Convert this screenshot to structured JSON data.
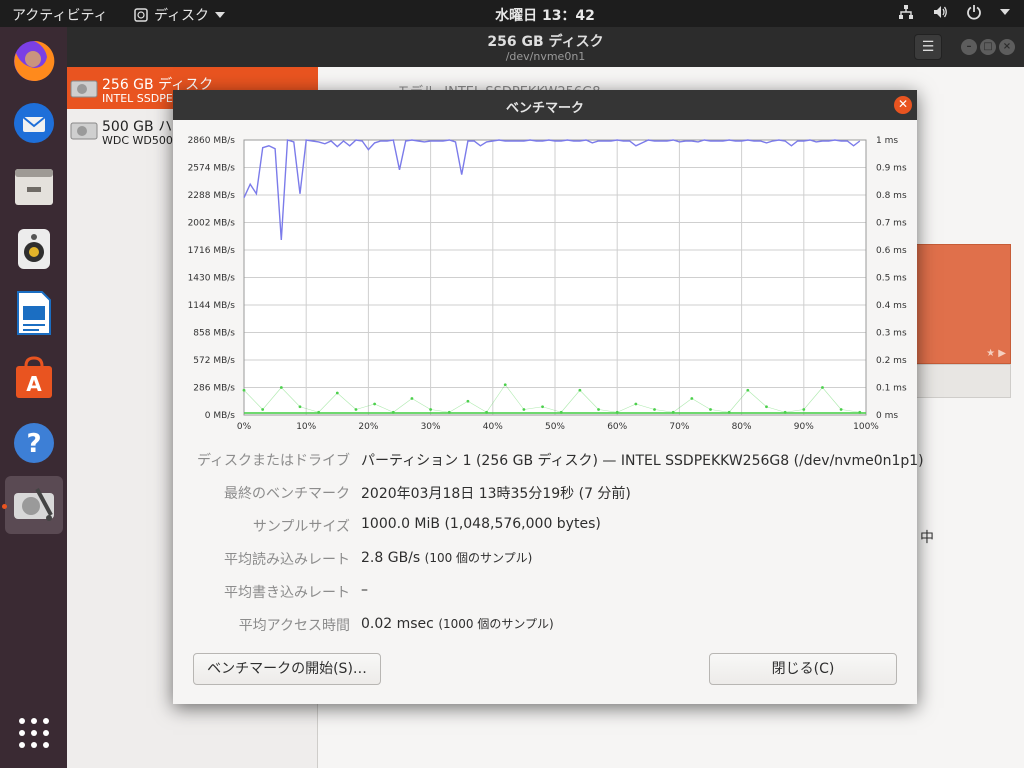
{
  "topbar": {
    "activities": "アクティビティ",
    "app_name": "ディスク",
    "clock": "水曜日 13：42"
  },
  "dock": {
    "items": [
      "firefox-icon",
      "thunderbird-icon",
      "files-icon",
      "rhythmbox-icon",
      "writer-icon",
      "software-icon",
      "help-icon",
      "disks-icon",
      "app-grid-icon"
    ]
  },
  "main_window": {
    "title": "256 GB ディスク",
    "subtitle": "/dev/nvme0n1",
    "drives": [
      {
        "name": "256 GB ディスク",
        "model": "INTEL SSDPE"
      },
      {
        "name": "500 GB ハー",
        "model": "WDC WD500"
      }
    ],
    "model_label": "モデル",
    "model_value": "INTEL SSDPEKKW256G8",
    "partial_text": "中"
  },
  "dialog": {
    "title": "ベンチマーク",
    "rows": [
      {
        "label": "ディスクまたはドライブ",
        "value": "パーティション 1 (256 GB ディスク) — INTEL SSDPEKKW256G8 (/dev/nvme0n1p1)",
        "note": ""
      },
      {
        "label": "最終のベンチマーク",
        "value": "2020年03月18日 13時35分19秒 (7 分前)",
        "note": ""
      },
      {
        "label": "サンプルサイズ",
        "value": "1000.0 MiB (1,048,576,000 bytes)",
        "note": ""
      },
      {
        "label": "平均読み込みレート",
        "value": "2.8 GB/s",
        "note": "(100 個のサンプル)"
      },
      {
        "label": "平均書き込みレート",
        "value": "–",
        "note": ""
      },
      {
        "label": "平均アクセス時間",
        "value": "0.02 msec",
        "note": "(1000 個のサンプル)"
      }
    ],
    "start_button": "ベンチマークの開始(S)…",
    "close_button": "閉じる(C)"
  },
  "chart_data": {
    "type": "line",
    "x_ticks": [
      "0%",
      "10%",
      "20%",
      "30%",
      "40%",
      "50%",
      "60%",
      "70%",
      "80%",
      "90%",
      "100%"
    ],
    "y_left_ticks": [
      "2860 MB/s",
      "2574 MB/s",
      "2288 MB/s",
      "2002 MB/s",
      "1716 MB/s",
      "1430 MB/s",
      "1144 MB/s",
      "858 MB/s",
      "572 MB/s",
      "286 MB/s",
      "0 MB/s"
    ],
    "y_right_ticks": [
      "1 ms",
      "0.9 ms",
      "0.8 ms",
      "0.7 ms",
      "0.6 ms",
      "0.5 ms",
      "0.4 ms",
      "0.3 ms",
      "0.2 ms",
      "0.1 ms",
      "0 ms"
    ],
    "xlim": [
      0,
      100
    ],
    "ylim_left": [
      0,
      2860
    ],
    "ylim_right": [
      0,
      1
    ],
    "grid": true,
    "series": [
      {
        "color": "#7b7bea",
        "x": [
          0,
          1,
          2,
          3,
          4,
          5,
          6,
          7,
          8,
          9,
          10,
          11,
          12,
          13,
          14,
          15,
          16,
          17,
          18,
          19,
          20,
          21,
          22,
          23,
          24,
          25,
          26,
          27,
          28,
          29,
          30,
          31,
          32,
          33,
          34,
          35,
          36,
          37,
          38,
          39,
          40,
          41,
          42,
          43,
          44,
          45,
          46,
          47,
          48,
          49,
          50,
          51,
          52,
          53,
          54,
          55,
          56,
          57,
          58,
          59,
          60,
          61,
          62,
          63,
          64,
          65,
          66,
          67,
          68,
          69,
          70,
          71,
          72,
          73,
          74,
          75,
          76,
          77,
          78,
          79,
          80,
          81,
          82,
          83,
          84,
          85,
          86,
          87,
          88,
          89,
          90,
          91,
          92,
          93,
          94,
          95,
          96,
          97,
          98,
          99
        ],
        "values": [
          2260,
          2400,
          2300,
          2780,
          2800,
          2770,
          1820,
          2860,
          2840,
          2300,
          2860,
          2850,
          2840,
          2820,
          2850,
          2790,
          2850,
          2800,
          2860,
          2850,
          2760,
          2830,
          2850,
          2850,
          2860,
          2550,
          2850,
          2860,
          2850,
          2840,
          2850,
          2850,
          2850,
          2860,
          2840,
          2500,
          2850,
          2850,
          2800,
          2840,
          2850,
          2860,
          2850,
          2850,
          2850,
          2850,
          2860,
          2850,
          2850,
          2860,
          2850,
          2850,
          2860,
          2850,
          2850,
          2860,
          2830,
          2850,
          2850,
          2850,
          2860,
          2850,
          2850,
          2800,
          2830,
          2860,
          2850,
          2850,
          2850,
          2860,
          2840,
          2850,
          2850,
          2840,
          2860,
          2850,
          2850,
          2850,
          2860,
          2850,
          2850,
          2860,
          2850,
          2850,
          2830,
          2850,
          2860,
          2850,
          2800,
          2850,
          2850,
          2860,
          2840,
          2850,
          2850,
          2860,
          2850,
          2850,
          2800,
          2850
        ]
      },
      {
        "color": "#4cd04c",
        "axis": "right",
        "x": [
          0,
          3,
          6,
          9,
          12,
          15,
          18,
          21,
          24,
          27,
          30,
          33,
          36,
          39,
          42,
          45,
          48,
          51,
          54,
          57,
          60,
          63,
          66,
          69,
          72,
          75,
          78,
          81,
          84,
          87,
          90,
          93,
          96,
          99
        ],
        "values": [
          0.09,
          0.02,
          0.1,
          0.03,
          0.01,
          0.08,
          0.02,
          0.04,
          0.01,
          0.06,
          0.02,
          0.01,
          0.05,
          0.01,
          0.11,
          0.02,
          0.03,
          0.01,
          0.09,
          0.02,
          0.01,
          0.04,
          0.02,
          0.01,
          0.06,
          0.02,
          0.01,
          0.09,
          0.03,
          0.01,
          0.02,
          0.1,
          0.02,
          0.01
        ]
      }
    ]
  }
}
